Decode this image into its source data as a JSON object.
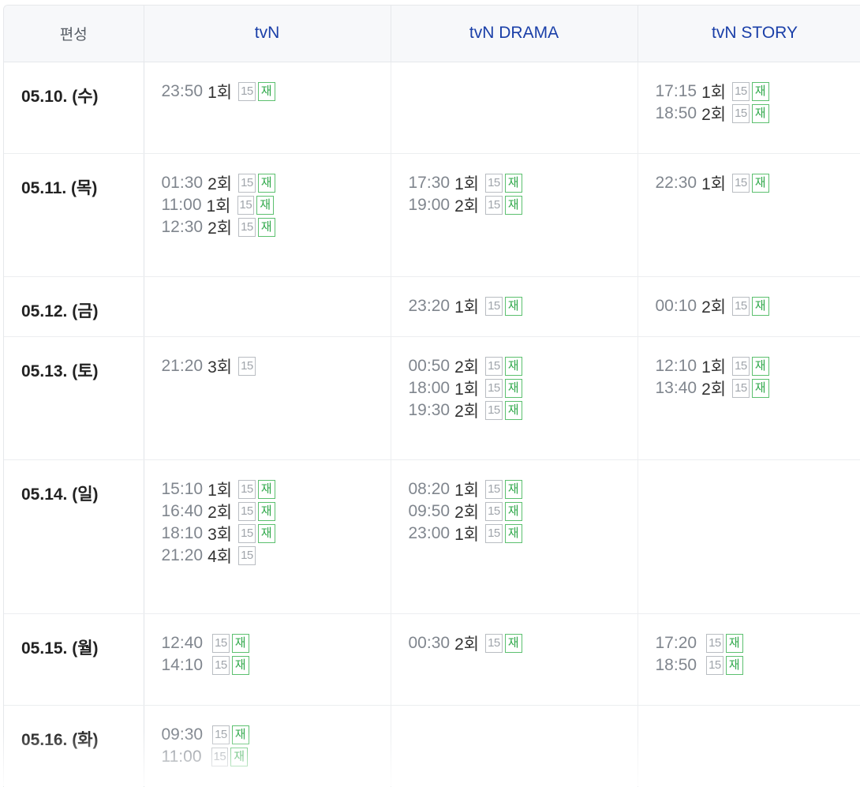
{
  "header": {
    "first": "편성",
    "channels": [
      "tvN",
      "tvN DRAMA",
      "tvN STORY"
    ]
  },
  "badges": {
    "rating": "15",
    "rerun": "재"
  },
  "rows": [
    {
      "date": "05.10. (수)",
      "cells": [
        [
          {
            "time": "23:50",
            "ep": "1회",
            "rerun": true
          }
        ],
        [],
        [
          {
            "time": "17:15",
            "ep": "1회",
            "rerun": true
          },
          {
            "time": "18:50",
            "ep": "2회",
            "rerun": true
          }
        ]
      ]
    },
    {
      "date": "05.11. (목)",
      "cells": [
        [
          {
            "time": "01:30",
            "ep": "2회",
            "rerun": true
          },
          {
            "time": "11:00",
            "ep": "1회",
            "rerun": true
          },
          {
            "time": "12:30",
            "ep": "2회",
            "rerun": true
          }
        ],
        [
          {
            "time": "17:30",
            "ep": "1회",
            "rerun": true
          },
          {
            "time": "19:00",
            "ep": "2회",
            "rerun": true
          }
        ],
        [
          {
            "time": "22:30",
            "ep": "1회",
            "rerun": true
          }
        ]
      ]
    },
    {
      "date": "05.12. (금)",
      "cells": [
        [],
        [
          {
            "time": "23:20",
            "ep": "1회",
            "rerun": true
          }
        ],
        [
          {
            "time": "00:10",
            "ep": "2회",
            "rerun": true
          }
        ]
      ]
    },
    {
      "date": "05.13. (토)",
      "cells": [
        [
          {
            "time": "21:20",
            "ep": "3회",
            "rerun": false
          }
        ],
        [
          {
            "time": "00:50",
            "ep": "2회",
            "rerun": true
          },
          {
            "time": "18:00",
            "ep": "1회",
            "rerun": true
          },
          {
            "time": "19:30",
            "ep": "2회",
            "rerun": true
          }
        ],
        [
          {
            "time": "12:10",
            "ep": "1회",
            "rerun": true
          },
          {
            "time": "13:40",
            "ep": "2회",
            "rerun": true
          }
        ]
      ]
    },
    {
      "date": "05.14. (일)",
      "cells": [
        [
          {
            "time": "15:10",
            "ep": "1회",
            "rerun": true
          },
          {
            "time": "16:40",
            "ep": "2회",
            "rerun": true
          },
          {
            "time": "18:10",
            "ep": "3회",
            "rerun": true
          },
          {
            "time": "21:20",
            "ep": "4회",
            "rerun": false
          }
        ],
        [
          {
            "time": "08:20",
            "ep": "1회",
            "rerun": true
          },
          {
            "time": "09:50",
            "ep": "2회",
            "rerun": true
          },
          {
            "time": "23:00",
            "ep": "1회",
            "rerun": true
          }
        ],
        []
      ]
    },
    {
      "date": "05.15. (월)",
      "cells": [
        [
          {
            "time": "12:40",
            "ep": "",
            "rerun": true
          },
          {
            "time": "14:10",
            "ep": "",
            "rerun": true
          }
        ],
        [
          {
            "time": "00:30",
            "ep": "2회",
            "rerun": true
          }
        ],
        [
          {
            "time": "17:20",
            "ep": "",
            "rerun": true
          },
          {
            "time": "18:50",
            "ep": "",
            "rerun": true
          }
        ]
      ]
    },
    {
      "date": "05.16. (화)",
      "cells": [
        [
          {
            "time": "09:30",
            "ep": "",
            "rerun": true
          },
          {
            "time": "11:00",
            "ep": "",
            "rerun": true
          }
        ],
        [],
        []
      ]
    }
  ]
}
